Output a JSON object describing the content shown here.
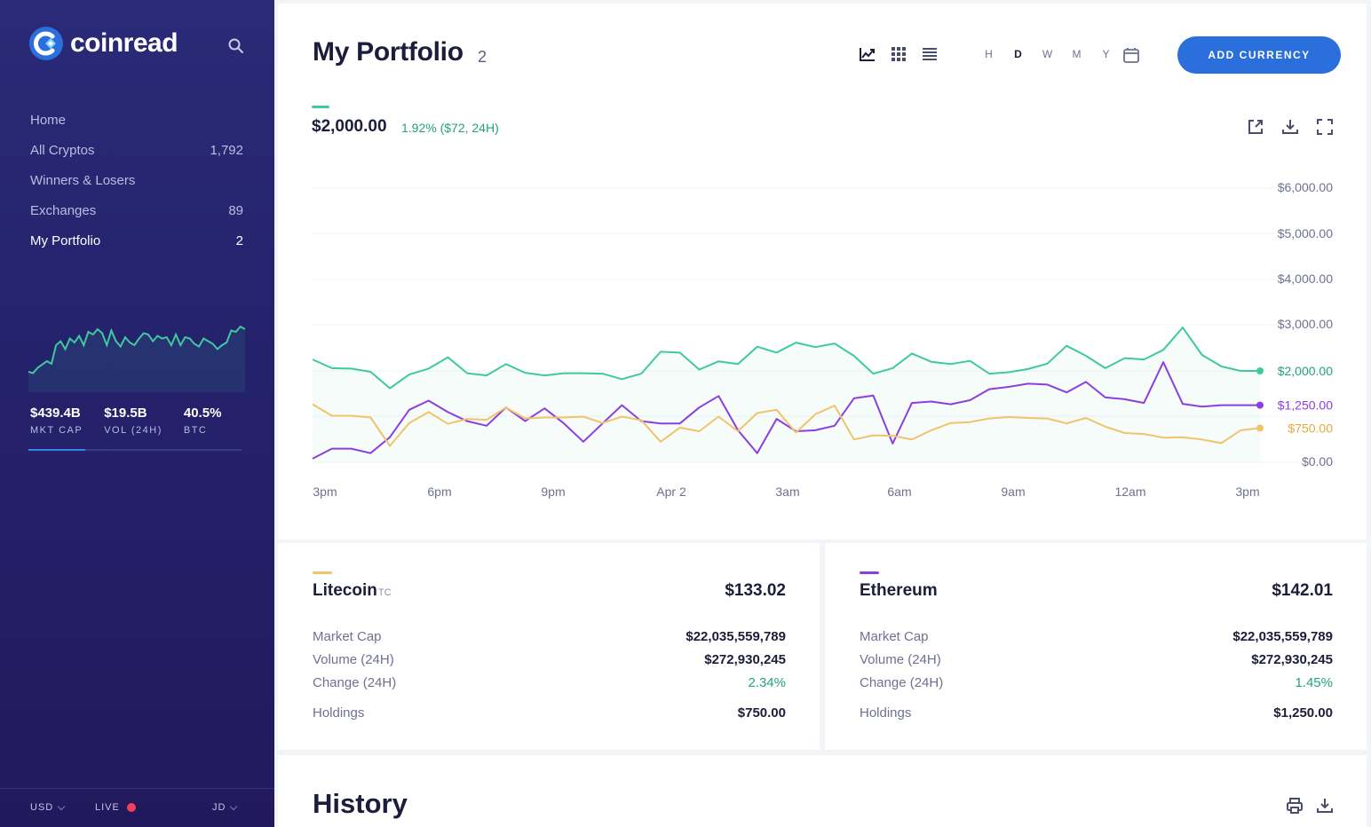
{
  "brand": {
    "name": "coinread"
  },
  "sidebar": {
    "nav": [
      {
        "label": "Home",
        "count": ""
      },
      {
        "label": "All Cryptos",
        "count": "1,792"
      },
      {
        "label": "Winners & Losers",
        "count": ""
      },
      {
        "label": "Exchanges",
        "count": "89"
      },
      {
        "label": "My Portfolio",
        "count": "2"
      }
    ],
    "active_item": "My Portfolio",
    "market_sparkline": [
      20,
      18,
      26,
      31,
      36,
      32,
      60,
      66,
      54,
      70,
      64,
      74,
      60,
      80,
      76,
      84,
      78,
      60,
      82,
      66,
      58,
      72,
      64,
      60,
      70,
      78,
      76,
      66,
      74,
      70,
      72,
      60,
      76,
      60,
      72,
      70,
      62,
      58,
      70,
      66,
      62,
      54,
      60,
      64,
      82,
      80,
      88,
      84
    ],
    "stats": [
      {
        "value": "$439.4B",
        "label": "MKT CAP"
      },
      {
        "value": "$19.5B",
        "label": "VOL (24H)"
      },
      {
        "value": "40.5%",
        "label": "BTC"
      }
    ],
    "footer": {
      "currency": "USD",
      "live": "LIVE",
      "user": "JD"
    }
  },
  "header": {
    "title": "My Portfolio",
    "count": "2",
    "ranges": [
      "H",
      "D",
      "W",
      "M",
      "Y"
    ],
    "active_range": "D",
    "add_button": "ADD CURRENCY"
  },
  "summary": {
    "total": "$2,000.00",
    "change": "1.92% ($72, 24H)"
  },
  "colors": {
    "total": "#3ec99e",
    "ethereum": "#8b3fe0",
    "litecoin": "#f1c36a",
    "accent": "#2a6fdc",
    "green": "#23a472"
  },
  "chart_data": {
    "type": "line",
    "x_ticks": [
      "3pm",
      "6pm",
      "9pm",
      "Apr 2",
      "3am",
      "6am",
      "9am",
      "12am",
      "3pm"
    ],
    "y_ticks": [
      "$6,000.00",
      "$5,000.00",
      "$4,000.00",
      "$3,000.00",
      "$0.00"
    ],
    "ylim": [
      0,
      6000
    ],
    "grid": true,
    "end_labels": [
      "$2,000.00",
      "$1,250.00",
      "$750.00"
    ],
    "series": [
      {
        "key": "total",
        "values": [
          2250,
          2060,
          2050,
          1980,
          1620,
          1920,
          2050,
          2300,
          1950,
          1900,
          2150,
          1960,
          1900,
          1950,
          1950,
          1940,
          1820,
          1940,
          2420,
          2400,
          2030,
          2210,
          2150,
          2530,
          2400,
          2620,
          2520,
          2600,
          2330,
          1940,
          2060,
          2380,
          2200,
          2150,
          2220,
          1940,
          1970,
          2040,
          2160,
          2550,
          2330,
          2060,
          2280,
          2250,
          2460,
          2950,
          2350,
          2100,
          2000,
          2000
        ]
      },
      {
        "key": "ethereum",
        "values": [
          80,
          300,
          300,
          200,
          550,
          1150,
          1350,
          1100,
          900,
          800,
          1200,
          900,
          1180,
          850,
          450,
          850,
          1250,
          900,
          850,
          850,
          1200,
          1450,
          700,
          200,
          950,
          680,
          700,
          800,
          1400,
          1460,
          410,
          1300,
          1330,
          1270,
          1360,
          1600,
          1650,
          1720,
          1700,
          1530,
          1760,
          1420,
          1380,
          1300,
          2190,
          1280,
          1220,
          1250,
          1250,
          1250
        ]
      },
      {
        "key": "litecoin",
        "values": [
          1270,
          1020,
          1020,
          980,
          360,
          860,
          1100,
          840,
          950,
          930,
          1200,
          960,
          980,
          980,
          1000,
          860,
          1000,
          920,
          450,
          760,
          680,
          1000,
          680,
          1080,
          1150,
          650,
          1050,
          1240,
          500,
          590,
          580,
          500,
          700,
          860,
          880,
          960,
          990,
          970,
          960,
          850,
          970,
          780,
          640,
          620,
          540,
          550,
          500,
          420,
          700,
          750
        ]
      }
    ]
  },
  "coins": [
    {
      "name": "Litecoin",
      "symbol": "TC",
      "price": "$133.02",
      "rows": [
        {
          "label": "Market Cap",
          "value": "$22,035,559,789"
        },
        {
          "label": "Volume (24H)",
          "value": "$272,930,245"
        },
        {
          "label": "Change (24H)",
          "value": "2.34%"
        },
        {
          "label": "Holdings",
          "value": "$750.00"
        }
      ]
    },
    {
      "name": "Ethereum",
      "symbol": "",
      "price": "$142.01",
      "rows": [
        {
          "label": "Market Cap",
          "value": "$22,035,559,789"
        },
        {
          "label": "Volume (24H)",
          "value": "$272,930,245"
        },
        {
          "label": "Change (24H)",
          "value": "1.45%"
        },
        {
          "label": "Holdings",
          "value": "$1,250.00"
        }
      ]
    }
  ],
  "history": {
    "title": "History"
  },
  "icons": [
    "search-icon",
    "line-chart-icon",
    "grid-icon",
    "list-icon",
    "calendar-icon",
    "external-link-icon",
    "download-icon",
    "fullscreen-icon",
    "print-icon"
  ]
}
